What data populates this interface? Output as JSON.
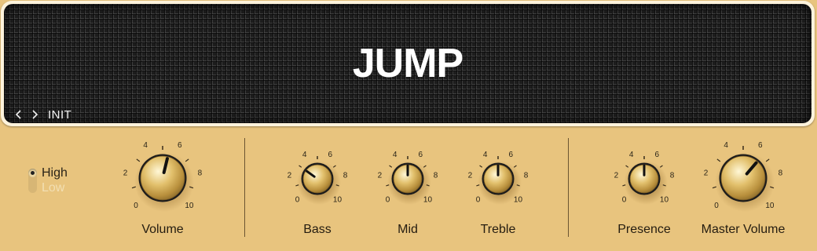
{
  "amp": {
    "name": "JUMP",
    "preset": {
      "name": "INIT",
      "prev_icon": "chevron-left-icon",
      "next_icon": "chevron-right-icon"
    }
  },
  "channel": {
    "options": [
      {
        "label": "High",
        "selected": true
      },
      {
        "label": "Low",
        "selected": false
      }
    ]
  },
  "knobs": [
    {
      "id": "volume",
      "label": "Volume",
      "value": 5.5
    },
    {
      "id": "bass",
      "label": "Bass",
      "value": 3.0
    },
    {
      "id": "mid",
      "label": "Mid",
      "value": 5.0
    },
    {
      "id": "treble",
      "label": "Treble",
      "value": 5.0
    },
    {
      "id": "presence",
      "label": "Presence",
      "value": 5.0
    },
    {
      "id": "master-volume",
      "label": "Master Volume",
      "value": 6.5
    }
  ],
  "scale": {
    "min": 0,
    "max": 10,
    "numbers": [
      "0",
      "2",
      "4",
      "6",
      "8",
      "10"
    ]
  },
  "colors": {
    "panel": "#e8c47e",
    "grille": "#1d1d1d",
    "knob_gold": "#d9b868",
    "pointer": "#111111"
  }
}
